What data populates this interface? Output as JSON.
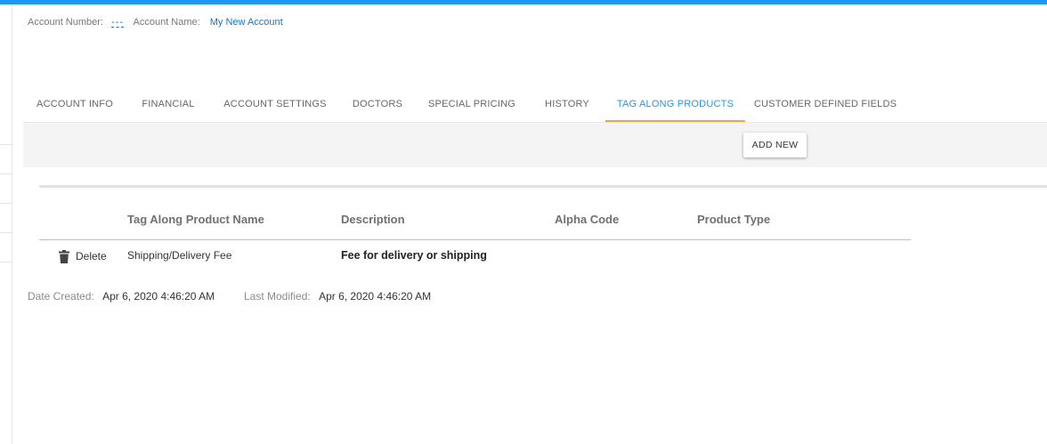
{
  "header": {
    "account_number_label": "Account Number:",
    "account_number_value": "---",
    "account_name_label": "Account Name:",
    "account_name_value": "My New Account"
  },
  "tabs": [
    {
      "label": "ACCOUNT INFO"
    },
    {
      "label": "FINANCIAL"
    },
    {
      "label": "ACCOUNT SETTINGS"
    },
    {
      "label": "DOCTORS"
    },
    {
      "label": "SPECIAL PRICING"
    },
    {
      "label": "HISTORY"
    },
    {
      "label": "TAG ALONG PRODUCTS",
      "active": true
    },
    {
      "label": "CUSTOMER DEFINED FIELDS"
    }
  ],
  "toolbar": {
    "add_new_label": "ADD NEW"
  },
  "grid": {
    "columns": [
      "Tag Along Product Name",
      "Description",
      "Alpha Code",
      "Product Type"
    ],
    "rows": [
      {
        "action_label": "Delete",
        "action_icon": "trash-icon",
        "name": "Shipping/Delivery Fee",
        "description": "Fee for delivery or shipping",
        "alpha_code": "",
        "product_type": ""
      }
    ]
  },
  "footer": {
    "date_created_label": "Date Created:",
    "date_created_value": "Apr 6, 2020 4:46:20 AM",
    "last_modified_label": "Last Modified:",
    "last_modified_value": "Apr 6, 2020 4:46:20 AM"
  },
  "colors": {
    "accent": "#2196f3",
    "active_tab_underline": "#f0a73a",
    "link": "#1a73c9",
    "toolbar_bg": "#f4f4f4"
  }
}
